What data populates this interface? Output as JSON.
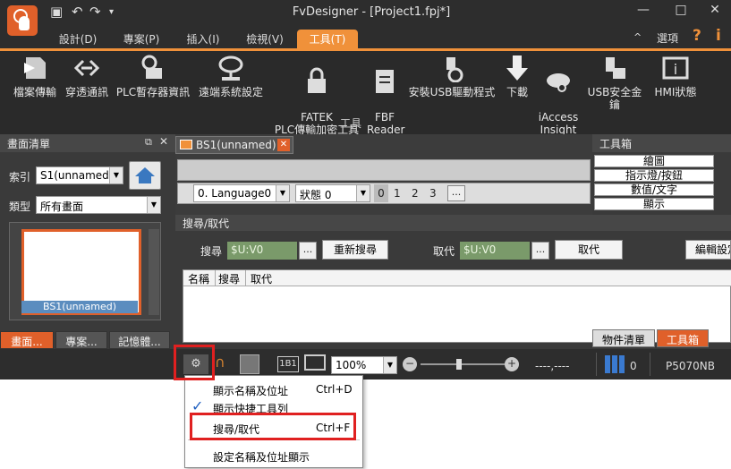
{
  "app": {
    "title": "FvDesigner - [Project1.fpj*]"
  },
  "window_controls": {
    "minimize": "—",
    "maximize": "□",
    "close": "✕"
  },
  "menu_tabs": [
    {
      "label": "設計(D)"
    },
    {
      "label": "專案(P)"
    },
    {
      "label": "插入(I)"
    },
    {
      "label": "檢視(V)"
    },
    {
      "label": "工具(T)"
    }
  ],
  "menu_right": {
    "options": "選項",
    "help": "?",
    "info": "i",
    "collapse": "^"
  },
  "ribbon": {
    "buttons": [
      {
        "label": "檔案傳輸"
      },
      {
        "label": "穿透通訊"
      },
      {
        "label": "PLC暫存器資訊"
      },
      {
        "label": "遠端系統設定"
      },
      {
        "label": "FATEK\nPLC傳輸加密工具"
      },
      {
        "label": "FBF\nReader"
      },
      {
        "label": "安裝USB驅動程式"
      },
      {
        "label": "下載"
      },
      {
        "label": "iAccess\nInsight"
      },
      {
        "label": "USB安全金鑰"
      },
      {
        "label": "HMI狀態"
      }
    ],
    "group_label": "工具"
  },
  "left_panel": {
    "title": "畫面清單",
    "index_label": "索引",
    "index_value": "S1(unnamed)",
    "type_label": "類型",
    "type_value": "所有畫面",
    "thumb_caption": "BS1(unnamed)",
    "bottom_tabs": [
      {
        "label": "畫面..."
      },
      {
        "label": "專案..."
      },
      {
        "label": "記憶體..."
      }
    ]
  },
  "document_tab": {
    "label": "BS1(unnamed)"
  },
  "editor_toolbar": {
    "language": "0.  Language0",
    "state": "狀態 0",
    "state_nums": [
      "0",
      "1",
      "2",
      "3"
    ],
    "more": "..."
  },
  "toolbox": {
    "title": "工具箱",
    "items": [
      {
        "label": "繪圖"
      },
      {
        "label": "指示燈/按鈕"
      },
      {
        "label": "數值/文字"
      },
      {
        "label": "顯示"
      }
    ]
  },
  "search_pane": {
    "title": "搜尋/取代",
    "search_label": "搜尋",
    "search_value": "$U:V0",
    "browse": "...",
    "research_button": "重新搜尋",
    "replace_label": "取代",
    "replace_value": "$U:V0",
    "replace_button": "取代",
    "edit_button": "編輯設定",
    "columns": [
      "名稱",
      "搜尋",
      "取代"
    ],
    "right_tabs": [
      {
        "label": "物件清單"
      },
      {
        "label": "工具箱"
      }
    ]
  },
  "status_bar": {
    "zoom": "100%",
    "coords": "----,----",
    "count": "0",
    "model": "P5070NB",
    "page_icon_text": "1B1"
  },
  "context_menu": {
    "items": [
      {
        "label": "顯示名稱及位址",
        "shortcut": "Ctrl+D",
        "checked": false
      },
      {
        "label": "顯示快捷工具列",
        "shortcut": "",
        "checked": true
      },
      {
        "label": "搜尋/取代",
        "shortcut": "Ctrl+F",
        "checked": false
      },
      {
        "label": "設定名稱及位址顯示",
        "shortcut": "",
        "checked": false
      }
    ],
    "check_mark": "✓"
  },
  "colors": {
    "accent": "#f0913a",
    "highlight": "#e02020",
    "chrome": "#2d2d2d"
  }
}
